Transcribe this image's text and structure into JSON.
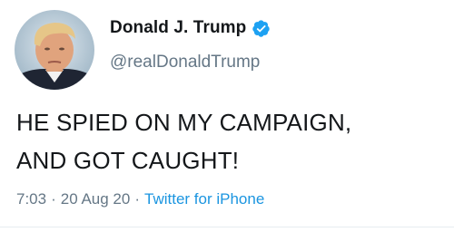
{
  "author": {
    "display_name": "Donald J. Trump",
    "handle": "@realDonaldTrump",
    "verified_icon": "verified-badge-icon",
    "avatar_icon": "profile-photo"
  },
  "tweet": {
    "text_line1": "HE SPIED ON MY CAMPAIGN,",
    "text_line2": "AND GOT CAUGHT!"
  },
  "meta": {
    "time": "7:03",
    "separator": "·",
    "date": "20 Aug 20",
    "source": "Twitter for iPhone"
  },
  "colors": {
    "text": "#14171a",
    "secondary": "#657786",
    "accent": "#1b95e0",
    "verified": "#1da1f2"
  }
}
